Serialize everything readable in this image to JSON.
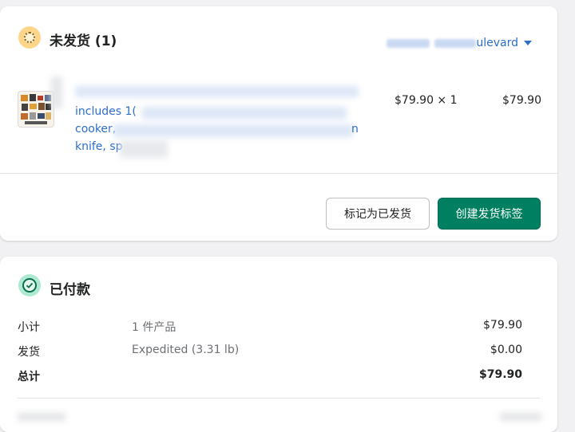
{
  "unfulfilled": {
    "title": "未发货 (1)",
    "location_suffix": "ulevard",
    "product": {
      "line1": "includes 1(",
      "line2": "cooker,",
      "line2_tail": "n",
      "line3": "knife, sp",
      "unit_price": "$79.90 × 1",
      "total": "$79.90"
    },
    "buttons": {
      "mark_fulfilled": "标记为已发货",
      "create_label": "创建发货标签"
    }
  },
  "paid": {
    "title": "已付款",
    "rows": [
      {
        "label": "小计",
        "desc": "1 件产品",
        "amount": "$79.90"
      },
      {
        "label": "发货",
        "desc": "Expedited (3.31 lb)",
        "amount": "$0.00"
      },
      {
        "label": "总计",
        "desc": "",
        "amount": "$79.90"
      }
    ]
  },
  "colors": {
    "primary": "#008060",
    "link": "#2c6ecb",
    "warning_badge": "#ffd58a",
    "success_badge": "#aee9d1"
  },
  "icons": {
    "unfulfilled_status": "unfulfilled-status-icon",
    "paid_status": "paid-check-icon",
    "location_dropdown": "chevron-down-icon"
  }
}
